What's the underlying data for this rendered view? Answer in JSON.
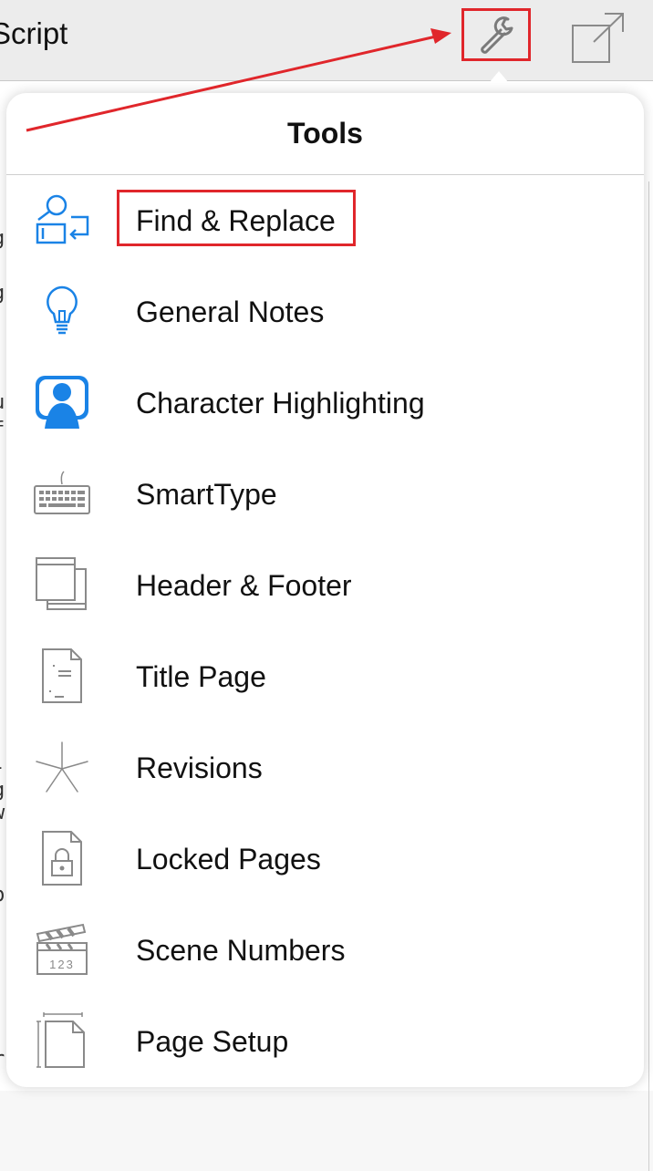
{
  "topbar": {
    "app_title": "Script",
    "tools_icon": "wrench-icon",
    "share_icon": "share-icon"
  },
  "popover": {
    "title": "Tools",
    "items": [
      {
        "label": "Find & Replace",
        "icon": "find-replace-icon",
        "highlighted": true
      },
      {
        "label": "General Notes",
        "icon": "lightbulb-icon"
      },
      {
        "label": "Character Highlighting",
        "icon": "person-icon"
      },
      {
        "label": "SmartType",
        "icon": "keyboard-icon"
      },
      {
        "label": "Header & Footer",
        "icon": "header-footer-icon"
      },
      {
        "label": "Title Page",
        "icon": "title-page-icon"
      },
      {
        "label": "Revisions",
        "icon": "asterisk-icon"
      },
      {
        "label": "Locked Pages",
        "icon": "locked-page-icon"
      },
      {
        "label": "Scene Numbers",
        "icon": "clapperboard-icon"
      },
      {
        "label": "Page Setup",
        "icon": "page-setup-icon"
      }
    ]
  },
  "annotations": {
    "color": "#e0262b"
  },
  "colors": {
    "accent_blue": "#1a83e6",
    "icon_gray": "#8a8a8a"
  },
  "clapper_text": "123"
}
